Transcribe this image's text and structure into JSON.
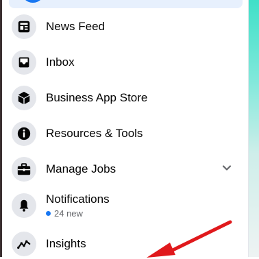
{
  "menu": {
    "items": [
      {
        "label": "News Feed",
        "icon": "news-feed-icon"
      },
      {
        "label": "Inbox",
        "icon": "inbox-icon"
      },
      {
        "label": "Business App Store",
        "icon": "cube-icon"
      },
      {
        "label": "Resources & Tools",
        "icon": "info-icon"
      },
      {
        "label": "Manage Jobs",
        "icon": "briefcase-icon",
        "expandable": true
      },
      {
        "label": "Notifications",
        "icon": "bell-icon",
        "sub": "24 new"
      },
      {
        "label": "Insights",
        "icon": "insights-icon"
      }
    ]
  },
  "colors": {
    "accent": "#1877f2",
    "annotation_arrow": "#e0191c",
    "icon_bg": "#e4e6eb"
  }
}
